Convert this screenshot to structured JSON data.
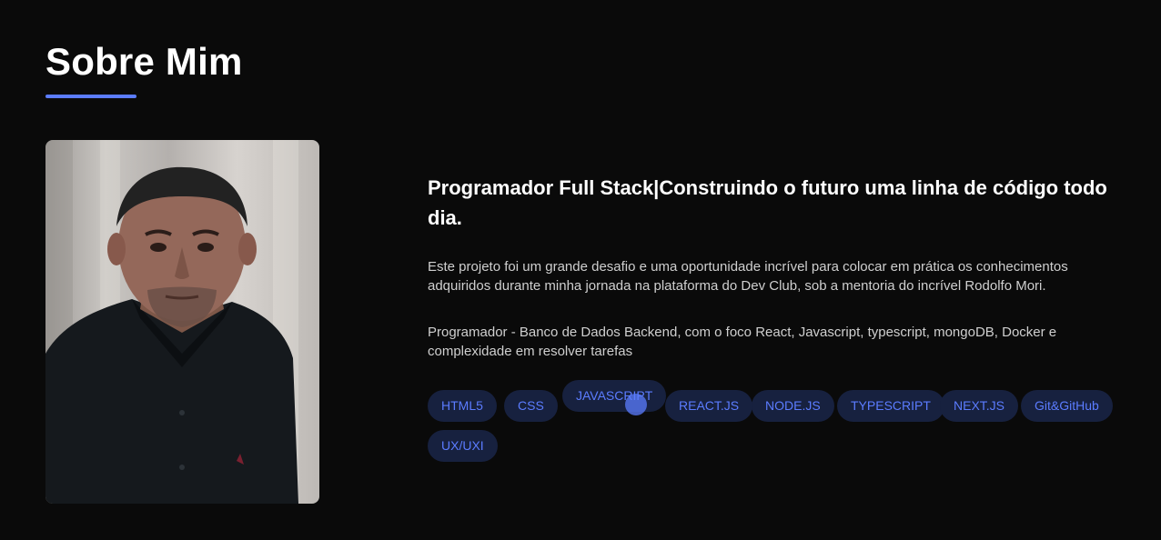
{
  "section": {
    "title": "Sobre Mim",
    "accent_color": "#5b7cff",
    "background": "#0a0a0a"
  },
  "profile": {
    "photo": "portrait-photo"
  },
  "about": {
    "headline": "Programador Full Stack|Construindo o futuro uma linha de código todo dia.",
    "paragraph_1": "Este projeto foi um grande desafio e uma oportunidade incrível para colocar em prática os conhecimentos adquiridos durante minha jornada na plataforma do Dev Club, sob a mentoria do incrível Rodolfo Mori.",
    "paragraph_2": "Programador - Banco de Dados Backend, com o foco React, Javascript, typescript, mongoDB, Docker e complexidade em resolver tarefas"
  },
  "skills": [
    "HTML5",
    "CSS",
    "JAVASCRIPT",
    "REACT.JS",
    "NODE.JS",
    "TYPESCRIPT",
    "NEXT.JS",
    "Git&GitHub",
    "UX/UXI"
  ]
}
